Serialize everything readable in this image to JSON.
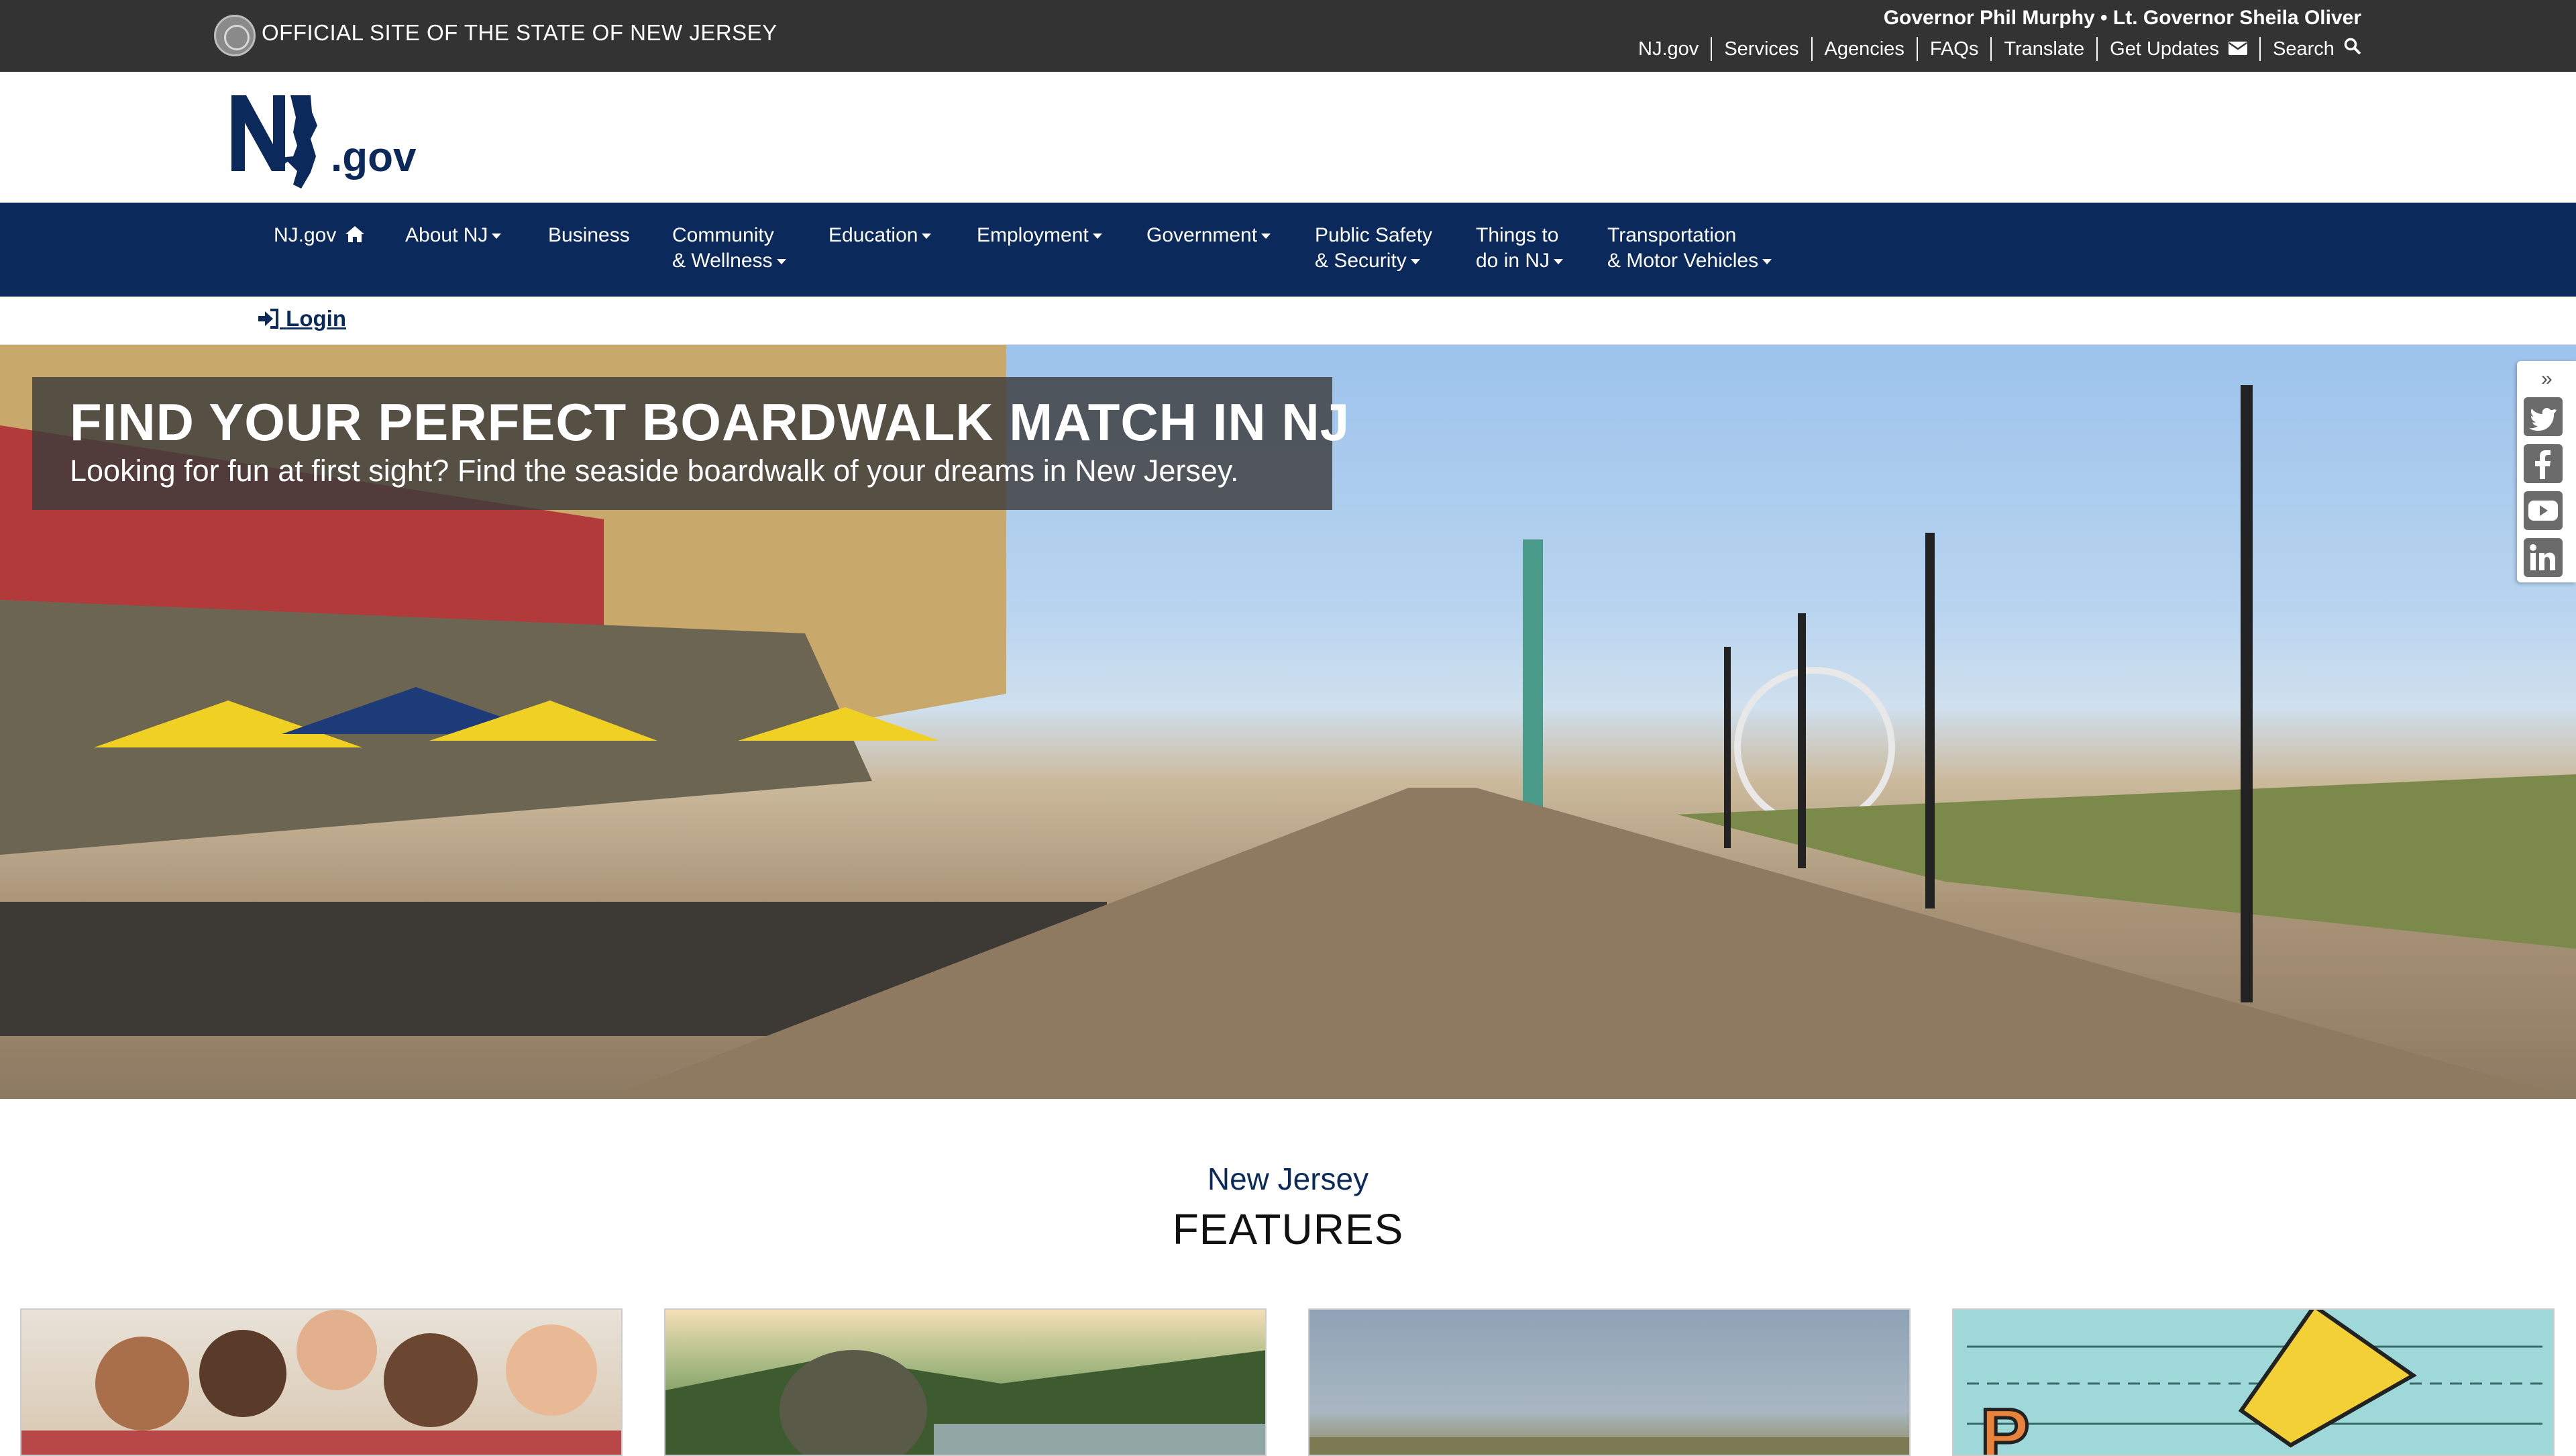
{
  "topbar": {
    "official_label": "OFFICIAL SITE OF THE STATE OF NEW JERSEY",
    "governor_label": "Governor Phil Murphy • Lt. Governor Sheila Oliver",
    "links": [
      "NJ.gov",
      "Services",
      "Agencies",
      "FAQs",
      "Translate",
      "Get Updates",
      "Search"
    ]
  },
  "logo": {
    "nj_text": "NJ",
    "gov_text": ".gov"
  },
  "nav": {
    "home": "NJ.gov",
    "about": "About NJ",
    "business": "Business",
    "community_line1": "Community",
    "community_line2": "& Wellness",
    "education": "Education",
    "employment": "Employment",
    "government": "Government",
    "safety_line1": "Public Safety",
    "safety_line2": "& Security",
    "things_line1": "Things to",
    "things_line2": "do in NJ",
    "transport_line1": "Transportation",
    "transport_line2": "& Motor Vehicles"
  },
  "login_label": "Login",
  "hero": {
    "title": "FIND YOUR PERFECT BOARDWALK MATCH IN NJ",
    "subtitle": "Looking for fun at first sight? Find the seaside boardwalk of your dreams in New Jersey."
  },
  "social": [
    "twitter-icon",
    "facebook-icon",
    "youtube-icon",
    "linkedin-icon"
  ],
  "features": {
    "pre": "New Jersey",
    "title": "FEATURES"
  },
  "colors": {
    "topbar": "#333333",
    "nav": "#0b2a5b",
    "accent": "#0b2a5b"
  }
}
